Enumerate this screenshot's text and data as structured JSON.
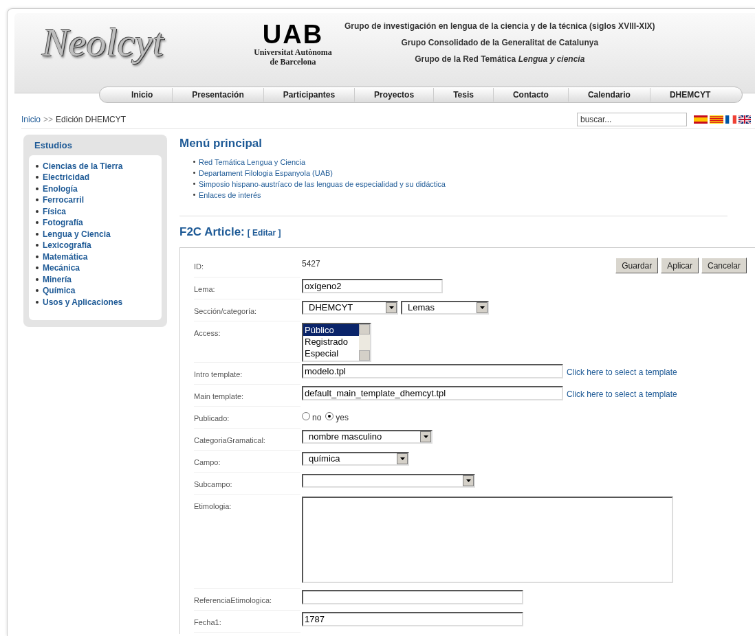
{
  "header": {
    "logo": "Neolcyt",
    "university": {
      "mark": "UAB",
      "lines": [
        "Universitat Autònoma",
        "de Barcelona"
      ]
    },
    "group_lines": [
      "Grupo de investigación en lengua de la ciencia y de la técnica (siglos XVIII-XIX)",
      "Grupo Consolidado de la Generalitat de Catalunya",
      "Grupo de la Red Temática *Lengua y ciencia*"
    ]
  },
  "nav": {
    "items": [
      "Inicio",
      "Presentación",
      "Participantes",
      "Proyectos",
      "Tesis",
      "Contacto",
      "Calendario",
      "DHEMCYT"
    ]
  },
  "breadcrumb": {
    "link": "Inicio",
    "separator": ">>",
    "current": "Edición DHEMCYT"
  },
  "search": {
    "placeholder": "buscar..."
  },
  "sidebar": {
    "title": "Estudios",
    "items": [
      "Ciencias de la Tierra",
      "Electricidad",
      "Enología",
      "Ferrocarril",
      "Física",
      "Fotografía",
      "Lengua y Ciencia",
      "Lexicografía",
      "Matemática",
      "Mecánica",
      "Minería",
      "Química",
      "Usos y Aplicaciones"
    ]
  },
  "main_menu": {
    "title": "Menú principal",
    "links": [
      "Red Temática Lengua y Ciencia",
      "Departament Filologia Espanyola (UAB)",
      "Simposio hispano-austríaco de las lenguas de especialidad y su didáctica",
      "Enlaces de interés"
    ]
  },
  "article": {
    "title": "F2C Article:",
    "edit_link": "[ Editar ]"
  },
  "form": {
    "buttons": [
      "Guardar",
      "Aplicar",
      "Cancelar"
    ],
    "fields": [
      {
        "label": "ID:",
        "kind": "static",
        "value": "5427"
      },
      {
        "label": "Lema:",
        "kind": "input",
        "value": "oxígeno2"
      },
      {
        "label": "Sección/categoría:",
        "kind": "selects",
        "options": [
          "DHEMCYT",
          "Lemas"
        ]
      },
      {
        "label": "Access:",
        "kind": "listbox",
        "options": [
          {
            "label": "Público",
            "selected": true
          },
          {
            "label": "Registrado",
            "selected": false
          },
          {
            "label": "Especial",
            "selected": false
          }
        ]
      },
      {
        "label": "Intro template:",
        "kind": "input_link",
        "value": "modelo.tpl",
        "link": "Click here to select a template"
      },
      {
        "label": "Main template:",
        "kind": "input_link",
        "value": "default_main_template_dhemcyt.tpl",
        "link": "Click here to select a template"
      },
      {
        "label": "Publicado:",
        "kind": "radio",
        "options": [
          {
            "label": "no",
            "selected": false
          },
          {
            "label": "yes",
            "selected": true
          }
        ]
      },
      {
        "label": "CategoriaGramatical:",
        "kind": "select",
        "value": "nombre masculino"
      },
      {
        "label": "Campo:",
        "kind": "select",
        "value": "química"
      },
      {
        "label": "Subcampo:",
        "kind": "select"
      },
      {
        "label": "Etimologia:",
        "kind": "textarea"
      },
      {
        "label": "ReferenciaEtimologica:",
        "kind": "input"
      },
      {
        "label": "Fecha1:",
        "kind": "input",
        "value": "1787"
      }
    ]
  }
}
